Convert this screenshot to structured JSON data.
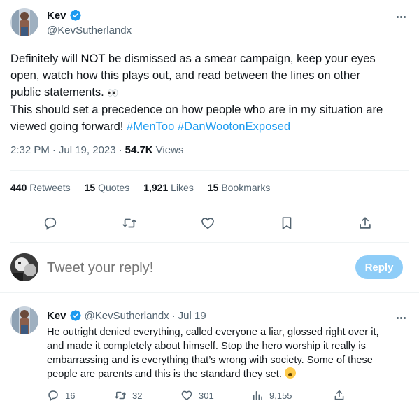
{
  "main_tweet": {
    "author": {
      "display_name": "Kev",
      "handle": "@KevSutherlandx"
    },
    "text_lines": [
      "Definitely will NOT be dismissed as a smear campaign, keep your eyes",
      "open, watch how this plays out, and read between the lines on other",
      "public statements."
    ],
    "emoji_eyes": "👀",
    "text_line4": "This should set a precedence on how people who are in my situation are",
    "text_line5_prefix": "viewed going forward!",
    "hashtags": [
      "#MenToo",
      "#DanWootonExposed"
    ],
    "time": "2:32 PM",
    "date": "Jul 19, 2023",
    "views_count": "54.7K",
    "views_label": "Views",
    "stats": {
      "retweets": {
        "count": "440",
        "label": "Retweets"
      },
      "quotes": {
        "count": "15",
        "label": "Quotes"
      },
      "likes": {
        "count": "1,921",
        "label": "Likes"
      },
      "bookmarks": {
        "count": "15",
        "label": "Bookmarks"
      }
    }
  },
  "reply_box": {
    "placeholder": "Tweet your reply!",
    "button_label": "Reply"
  },
  "reply_tweet": {
    "author": {
      "display_name": "Kev",
      "handle": "@KevSutherlandx"
    },
    "date": "Jul 19",
    "text_lines": [
      "He outright denied everything, called everyone a liar, glossed right over it,",
      "and made it completely about himself. Stop the hero worship it really is",
      "embarrassing and is everything that’s wrong with society. Some of these",
      "people are parents and this is the standard they set."
    ],
    "counts": {
      "replies": "16",
      "retweets": "32",
      "likes": "301",
      "views": "9,155"
    }
  },
  "colors": {
    "accent": "#1d9bf0",
    "reply_button_bg": "#8ecdf8",
    "secondary_text": "#536471",
    "primary_text": "#0f1419",
    "divider": "#eff3f4"
  },
  "icons": {
    "verified": "verified-badge-icon",
    "more": "more-options-icon",
    "reply": "reply-icon",
    "retweet": "retweet-icon",
    "like": "heart-icon",
    "bookmark": "bookmark-icon",
    "share": "share-icon",
    "views": "analytics-icon"
  }
}
